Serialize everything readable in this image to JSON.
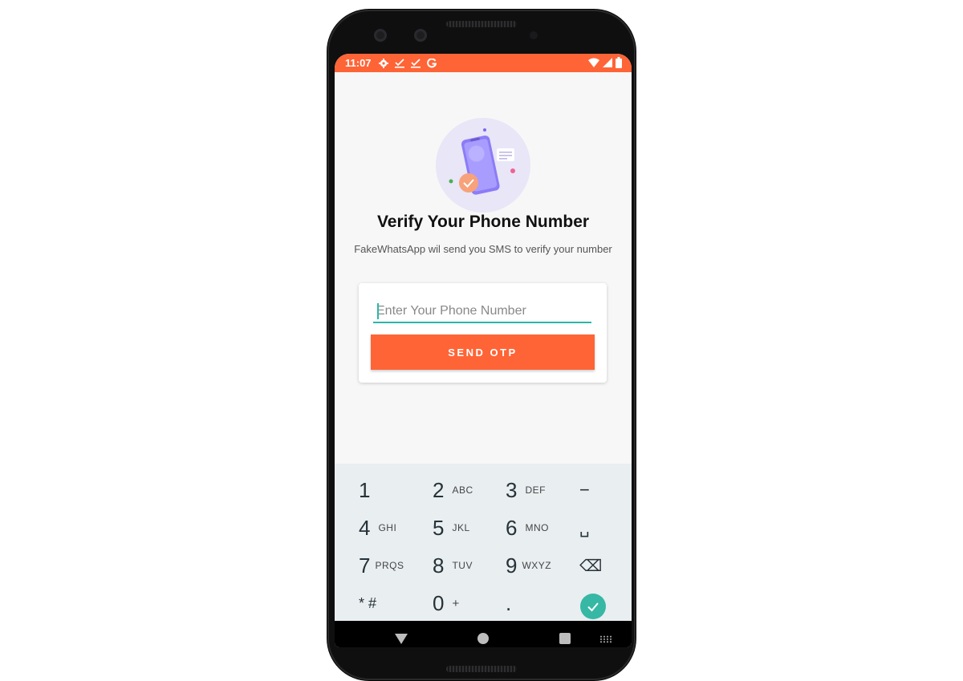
{
  "status_bar": {
    "time": "11:07",
    "left_icons": [
      "settings-icon",
      "check-icon",
      "check-icon",
      "google-icon"
    ],
    "right_icons": [
      "wifi-icon",
      "signal-icon",
      "battery-icon"
    ],
    "background_color": "#ff6436"
  },
  "verify": {
    "title": "Verify Your Phone Number",
    "subtitle": "FakeWhatsApp wil send you SMS to verify your number",
    "input_placeholder": "Enter Your Phone Number",
    "input_value": "",
    "button_label": "SEND OTP",
    "accent_color": "#ff6436",
    "input_underline_color": "#2ab7a6"
  },
  "keypad": {
    "keys": [
      {
        "digit": "1",
        "letters": ""
      },
      {
        "digit": "2",
        "letters": "ABC"
      },
      {
        "digit": "3",
        "letters": "DEF"
      },
      {
        "digit": "−",
        "letters": ""
      },
      {
        "digit": "4",
        "letters": "GHI"
      },
      {
        "digit": "5",
        "letters": "JKL"
      },
      {
        "digit": "6",
        "letters": "MNO"
      },
      {
        "digit": "␣",
        "letters": ""
      },
      {
        "digit": "7",
        "letters": "PRQS"
      },
      {
        "digit": "8",
        "letters": "TUV"
      },
      {
        "digit": "9",
        "letters": "WXYZ"
      },
      {
        "digit": "⌫",
        "letters": ""
      },
      {
        "digit": "* #",
        "letters": ""
      },
      {
        "digit": "0",
        "letters": "+"
      },
      {
        "digit": ".",
        "letters": ""
      }
    ],
    "done_icon": "check-icon",
    "done_color": "#36b8a5"
  },
  "nav_bar": {
    "icons": [
      "back-icon",
      "home-icon",
      "recents-icon",
      "keyboard-icon"
    ]
  }
}
